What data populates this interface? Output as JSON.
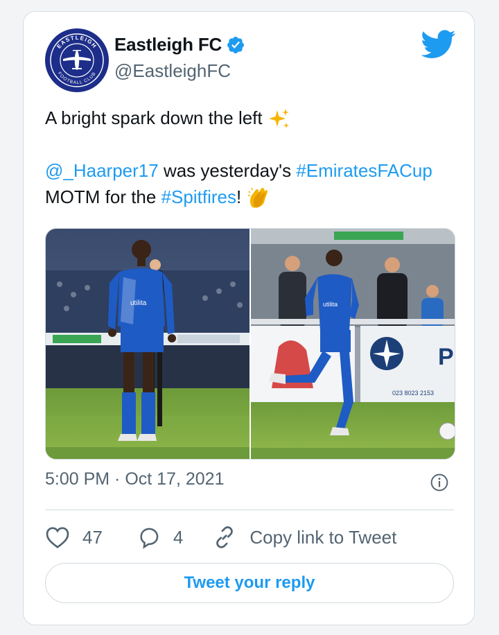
{
  "account": {
    "name": "Eastleigh FC",
    "handle": "@EastleighFC",
    "logo_text_top": "EASTLEIGH",
    "logo_text_bottom": "FOOTBALL CLUB"
  },
  "tweet": {
    "line1": "A bright spark down the left",
    "line1_emoji": "sparkles-emoji",
    "mention": "@_Haarper17",
    "line2_mid": " was yesterday's ",
    "hashtag1": "#EmiratesFACup",
    "line3_start": "MOTM for the ",
    "hashtag2": "#Spitfires",
    "line3_end": "!",
    "line3_emoji": "clapping-hands-emoji"
  },
  "media": {
    "photo1_sponsor": "utilita",
    "photo2_sponsor": "utilita",
    "photo2_board_phone": "023 8023 2153"
  },
  "timestamp": "5:00 PM · Oct 17, 2021",
  "actions": {
    "likes": "47",
    "replies": "4",
    "copy_link": "Copy link to Tweet"
  },
  "reply_button": "Tweet your reply",
  "colors": {
    "accent": "#1d9bf0",
    "text": "#0f1419",
    "muted": "#536471",
    "border": "#cfd9de",
    "club_blue": "#1d2e8a"
  }
}
